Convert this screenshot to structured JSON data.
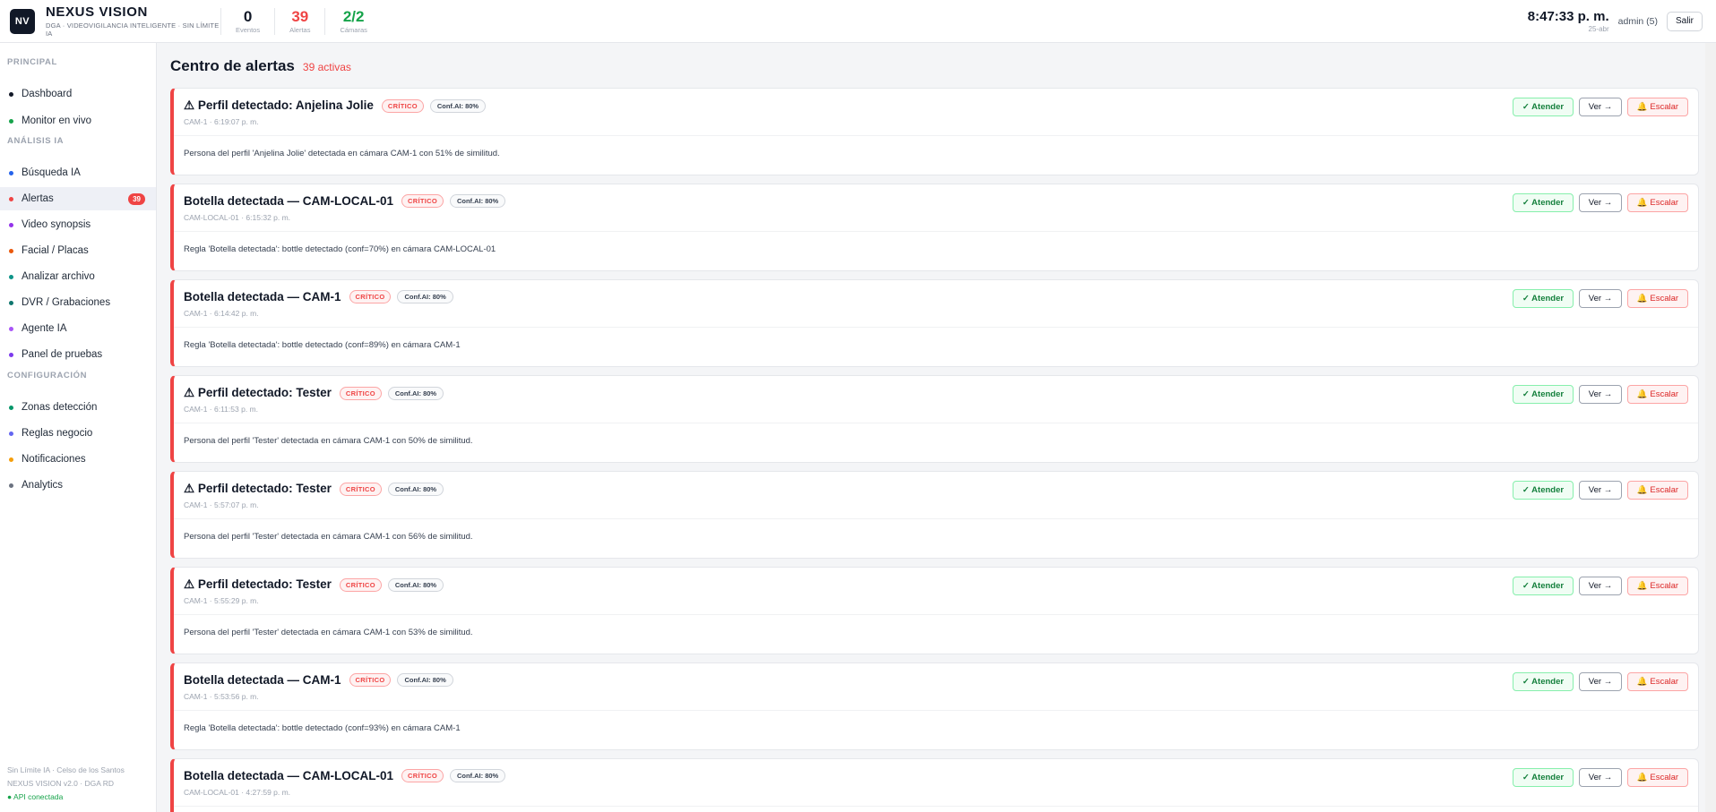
{
  "header": {
    "logo": "NV",
    "brand": "NEXUS VISION",
    "subtitle": "DGA · VIDEOVIGILANCIA INTELIGENTE · SIN LÍMITE IA",
    "stats": [
      {
        "value": "0",
        "label": "Eventos"
      },
      {
        "value": "39",
        "label": "Alertas"
      },
      {
        "value": "2/2",
        "label": "Cámaras"
      }
    ],
    "time": "8:47:33 p. m.",
    "date": "25-abr",
    "user": "admin (5)",
    "logout": "Salir"
  },
  "sidebar": {
    "sections": [
      {
        "title": "PRINCIPAL",
        "items": [
          {
            "label": "Dashboard",
            "dot": "#111827"
          },
          {
            "label": "Monitor en vivo",
            "dot": "#16a34a"
          }
        ]
      },
      {
        "title": "ANÁLISIS IA",
        "items": [
          {
            "label": "Búsqueda IA",
            "dot": "#2563eb"
          },
          {
            "label": "Alertas",
            "dot": "#ef4444",
            "badge": "39",
            "active": true
          },
          {
            "label": "Video synopsis",
            "dot": "#9333ea"
          },
          {
            "label": "Facial / Placas",
            "dot": "#ea580c"
          },
          {
            "label": "Analizar archivo",
            "dot": "#0d9488"
          },
          {
            "label": "DVR / Grabaciones",
            "dot": "#0f766e"
          },
          {
            "label": "Agente IA",
            "dot": "#a855f7"
          },
          {
            "label": "Panel de pruebas",
            "dot": "#7c3aed"
          }
        ]
      },
      {
        "title": "CONFIGURACIÓN",
        "items": [
          {
            "label": "Zonas detección",
            "dot": "#059669"
          },
          {
            "label": "Reglas negocio",
            "dot": "#6366f1"
          },
          {
            "label": "Notificaciones",
            "dot": "#f59e0b"
          },
          {
            "label": "Analytics",
            "dot": "#6b7280"
          }
        ]
      }
    ],
    "footer": {
      "line1": "Sin Límite IA · Celso de los Santos",
      "line2": "NEXUS VISION v2.0 · DGA RD",
      "api": "● API conectada"
    }
  },
  "main": {
    "title": "Centro de alertas",
    "active_count": "39 activas",
    "action_labels": {
      "attend": "✓ Atender",
      "view": "Ver →",
      "escalate": "🔔 Escalar"
    },
    "alerts": [
      {
        "title": "⚠ Perfil detectado: Anjelina Jolie",
        "severity": "CRÍTICO",
        "conf": "Conf.AI: 80%",
        "meta": "CAM-1 · 6:19:07 p. m.",
        "desc": "Persona del perfil 'Anjelina Jolie' detectada en cámara CAM-1 con 51% de similitud."
      },
      {
        "title": "Botella detectada — CAM-LOCAL-01",
        "severity": "CRÍTICO",
        "conf": "Conf.AI: 80%",
        "meta": "CAM-LOCAL-01 · 6:15:32 p. m.",
        "desc": "Regla 'Botella detectada': bottle detectado (conf=70%) en cámara CAM-LOCAL-01"
      },
      {
        "title": "Botella detectada — CAM-1",
        "severity": "CRÍTICO",
        "conf": "Conf.AI: 80%",
        "meta": "CAM-1 · 6:14:42 p. m.",
        "desc": "Regla 'Botella detectada': bottle detectado (conf=89%) en cámara CAM-1"
      },
      {
        "title": "⚠ Perfil detectado: Tester",
        "severity": "CRÍTICO",
        "conf": "Conf.AI: 80%",
        "meta": "CAM-1 · 6:11:53 p. m.",
        "desc": "Persona del perfil 'Tester' detectada en cámara CAM-1 con 50% de similitud."
      },
      {
        "title": "⚠ Perfil detectado: Tester",
        "severity": "CRÍTICO",
        "conf": "Conf.AI: 80%",
        "meta": "CAM-1 · 5:57:07 p. m.",
        "desc": "Persona del perfil 'Tester' detectada en cámara CAM-1 con 56% de similitud."
      },
      {
        "title": "⚠ Perfil detectado: Tester",
        "severity": "CRÍTICO",
        "conf": "Conf.AI: 80%",
        "meta": "CAM-1 · 5:55:29 p. m.",
        "desc": "Persona del perfil 'Tester' detectada en cámara CAM-1 con 53% de similitud."
      },
      {
        "title": "Botella detectada — CAM-1",
        "severity": "CRÍTICO",
        "conf": "Conf.AI: 80%",
        "meta": "CAM-1 · 5:53:56 p. m.",
        "desc": "Regla 'Botella detectada': bottle detectado (conf=93%) en cámara CAM-1"
      },
      {
        "title": "Botella detectada — CAM-LOCAL-01",
        "severity": "CRÍTICO",
        "conf": "Conf.AI: 80%",
        "meta": "CAM-LOCAL-01 · 4:27:59 p. m.",
        "desc": ""
      }
    ]
  }
}
